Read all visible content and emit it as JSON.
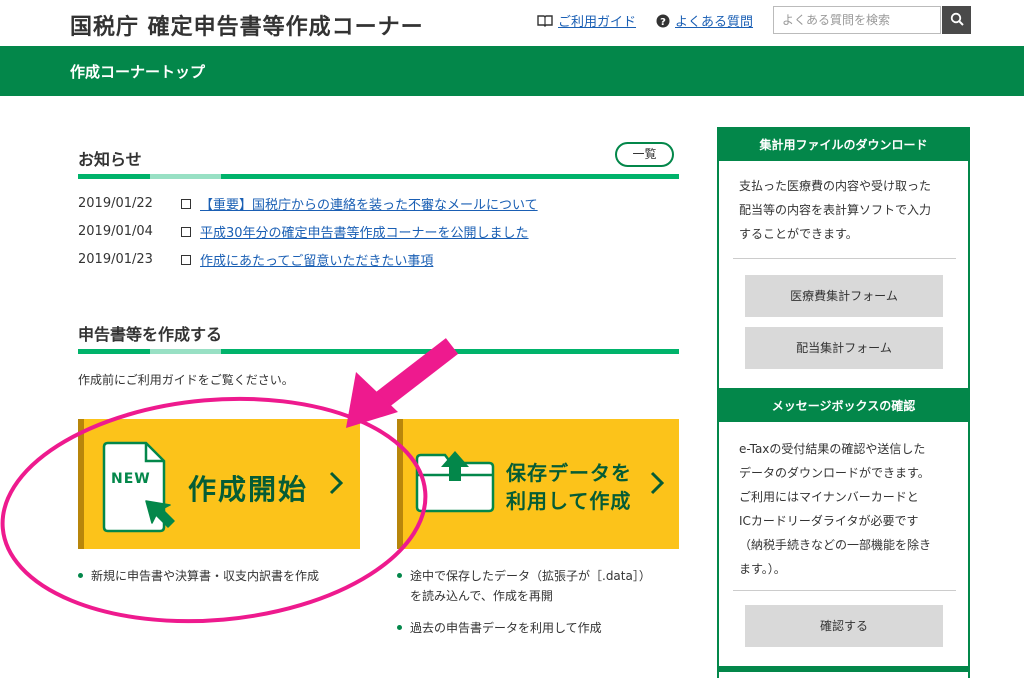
{
  "header": {
    "title": "国税庁 確定申告書等作成コーナー",
    "guide_link": "ご利用ガイド",
    "faq_link": "よくある質問",
    "search_placeholder": "よくある質問を検索"
  },
  "nav_bar": {
    "title": "作成コーナートップ"
  },
  "news": {
    "title": "お知らせ",
    "list_button": "一覧",
    "items": [
      {
        "date": "2019/01/22",
        "text": "【重要】国税庁からの連絡を装った不審なメールについて"
      },
      {
        "date": "2019/01/04",
        "text": "平成30年分の確定申告書等作成コーナーを公開しました"
      },
      {
        "date": "2019/01/23",
        "text": "作成にあたってご留意いただきたい事項"
      }
    ]
  },
  "create": {
    "title": "申告書等を作成する",
    "note": "作成前にご利用ガイドをご覧ください。",
    "start_card": {
      "badge": "NEW",
      "label": "作成開始"
    },
    "saved_card": {
      "label_line1": "保存データを",
      "label_line2": "利用して作成"
    },
    "start_bullets": [
      "新規に申告書や決算書・収支内訳書を作成"
    ],
    "saved_bullets": [
      {
        "line1": "途中で保存したデータ（拡張子が［.data］）",
        "line2": "を読み込んで、作成を再開"
      },
      {
        "line1": "過去の申告書データを利用して作成"
      }
    ]
  },
  "sidebar": {
    "download": {
      "title": "集計用ファイルのダウンロード",
      "desc_lines": [
        "支払った医療費の内容や受け取った",
        "配当等の内容を表計算ソフトで入力",
        "することができます。"
      ],
      "buttons": [
        "医療費集計フォーム",
        "配当集計フォーム"
      ]
    },
    "message_box": {
      "title": "メッセージボックスの確認",
      "desc_lines": [
        "e-Taxの受付結果の確認や送信した",
        "データのダウンロードができます。",
        "ご利用にはマイナンバーカードと",
        "ICカードリーダライタが必要です",
        "（納税手続きなどの一部機能を除き",
        "ます。）。"
      ],
      "button": "確認する"
    }
  },
  "colors": {
    "brand_green": "#03874a",
    "accent_green": "#00b36b",
    "card_yellow": "#fcc31a",
    "annotation_pink": "#ee1a8e",
    "link_blue": "#1a5fb4"
  }
}
